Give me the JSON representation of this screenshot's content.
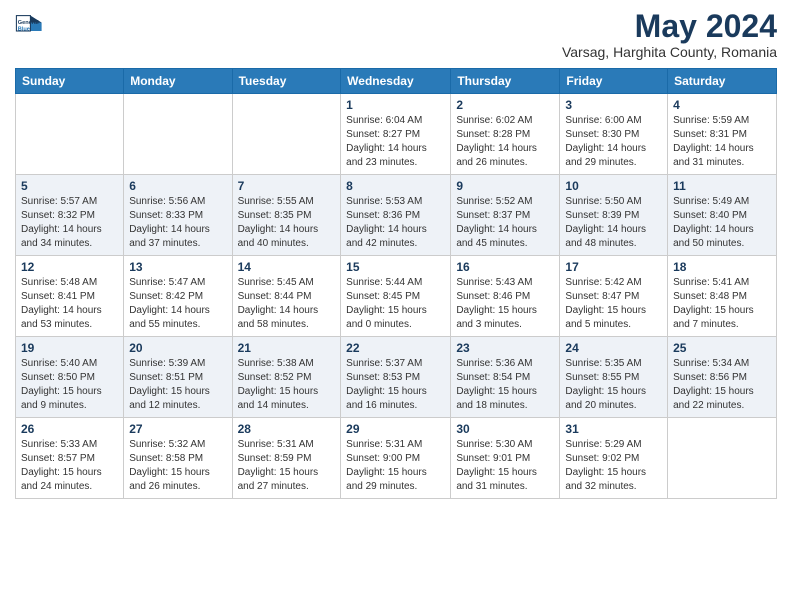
{
  "header": {
    "logo_line1": "General",
    "logo_line2": "Blue",
    "month": "May 2024",
    "location": "Varsag, Harghita County, Romania"
  },
  "weekdays": [
    "Sunday",
    "Monday",
    "Tuesday",
    "Wednesday",
    "Thursday",
    "Friday",
    "Saturday"
  ],
  "weeks": [
    [
      {
        "day": "",
        "info": ""
      },
      {
        "day": "",
        "info": ""
      },
      {
        "day": "",
        "info": ""
      },
      {
        "day": "1",
        "info": "Sunrise: 6:04 AM\nSunset: 8:27 PM\nDaylight: 14 hours\nand 23 minutes."
      },
      {
        "day": "2",
        "info": "Sunrise: 6:02 AM\nSunset: 8:28 PM\nDaylight: 14 hours\nand 26 minutes."
      },
      {
        "day": "3",
        "info": "Sunrise: 6:00 AM\nSunset: 8:30 PM\nDaylight: 14 hours\nand 29 minutes."
      },
      {
        "day": "4",
        "info": "Sunrise: 5:59 AM\nSunset: 8:31 PM\nDaylight: 14 hours\nand 31 minutes."
      }
    ],
    [
      {
        "day": "5",
        "info": "Sunrise: 5:57 AM\nSunset: 8:32 PM\nDaylight: 14 hours\nand 34 minutes."
      },
      {
        "day": "6",
        "info": "Sunrise: 5:56 AM\nSunset: 8:33 PM\nDaylight: 14 hours\nand 37 minutes."
      },
      {
        "day": "7",
        "info": "Sunrise: 5:55 AM\nSunset: 8:35 PM\nDaylight: 14 hours\nand 40 minutes."
      },
      {
        "day": "8",
        "info": "Sunrise: 5:53 AM\nSunset: 8:36 PM\nDaylight: 14 hours\nand 42 minutes."
      },
      {
        "day": "9",
        "info": "Sunrise: 5:52 AM\nSunset: 8:37 PM\nDaylight: 14 hours\nand 45 minutes."
      },
      {
        "day": "10",
        "info": "Sunrise: 5:50 AM\nSunset: 8:39 PM\nDaylight: 14 hours\nand 48 minutes."
      },
      {
        "day": "11",
        "info": "Sunrise: 5:49 AM\nSunset: 8:40 PM\nDaylight: 14 hours\nand 50 minutes."
      }
    ],
    [
      {
        "day": "12",
        "info": "Sunrise: 5:48 AM\nSunset: 8:41 PM\nDaylight: 14 hours\nand 53 minutes."
      },
      {
        "day": "13",
        "info": "Sunrise: 5:47 AM\nSunset: 8:42 PM\nDaylight: 14 hours\nand 55 minutes."
      },
      {
        "day": "14",
        "info": "Sunrise: 5:45 AM\nSunset: 8:44 PM\nDaylight: 14 hours\nand 58 minutes."
      },
      {
        "day": "15",
        "info": "Sunrise: 5:44 AM\nSunset: 8:45 PM\nDaylight: 15 hours\nand 0 minutes."
      },
      {
        "day": "16",
        "info": "Sunrise: 5:43 AM\nSunset: 8:46 PM\nDaylight: 15 hours\nand 3 minutes."
      },
      {
        "day": "17",
        "info": "Sunrise: 5:42 AM\nSunset: 8:47 PM\nDaylight: 15 hours\nand 5 minutes."
      },
      {
        "day": "18",
        "info": "Sunrise: 5:41 AM\nSunset: 8:48 PM\nDaylight: 15 hours\nand 7 minutes."
      }
    ],
    [
      {
        "day": "19",
        "info": "Sunrise: 5:40 AM\nSunset: 8:50 PM\nDaylight: 15 hours\nand 9 minutes."
      },
      {
        "day": "20",
        "info": "Sunrise: 5:39 AM\nSunset: 8:51 PM\nDaylight: 15 hours\nand 12 minutes."
      },
      {
        "day": "21",
        "info": "Sunrise: 5:38 AM\nSunset: 8:52 PM\nDaylight: 15 hours\nand 14 minutes."
      },
      {
        "day": "22",
        "info": "Sunrise: 5:37 AM\nSunset: 8:53 PM\nDaylight: 15 hours\nand 16 minutes."
      },
      {
        "day": "23",
        "info": "Sunrise: 5:36 AM\nSunset: 8:54 PM\nDaylight: 15 hours\nand 18 minutes."
      },
      {
        "day": "24",
        "info": "Sunrise: 5:35 AM\nSunset: 8:55 PM\nDaylight: 15 hours\nand 20 minutes."
      },
      {
        "day": "25",
        "info": "Sunrise: 5:34 AM\nSunset: 8:56 PM\nDaylight: 15 hours\nand 22 minutes."
      }
    ],
    [
      {
        "day": "26",
        "info": "Sunrise: 5:33 AM\nSunset: 8:57 PM\nDaylight: 15 hours\nand 24 minutes."
      },
      {
        "day": "27",
        "info": "Sunrise: 5:32 AM\nSunset: 8:58 PM\nDaylight: 15 hours\nand 26 minutes."
      },
      {
        "day": "28",
        "info": "Sunrise: 5:31 AM\nSunset: 8:59 PM\nDaylight: 15 hours\nand 27 minutes."
      },
      {
        "day": "29",
        "info": "Sunrise: 5:31 AM\nSunset: 9:00 PM\nDaylight: 15 hours\nand 29 minutes."
      },
      {
        "day": "30",
        "info": "Sunrise: 5:30 AM\nSunset: 9:01 PM\nDaylight: 15 hours\nand 31 minutes."
      },
      {
        "day": "31",
        "info": "Sunrise: 5:29 AM\nSunset: 9:02 PM\nDaylight: 15 hours\nand 32 minutes."
      },
      {
        "day": "",
        "info": ""
      }
    ]
  ]
}
